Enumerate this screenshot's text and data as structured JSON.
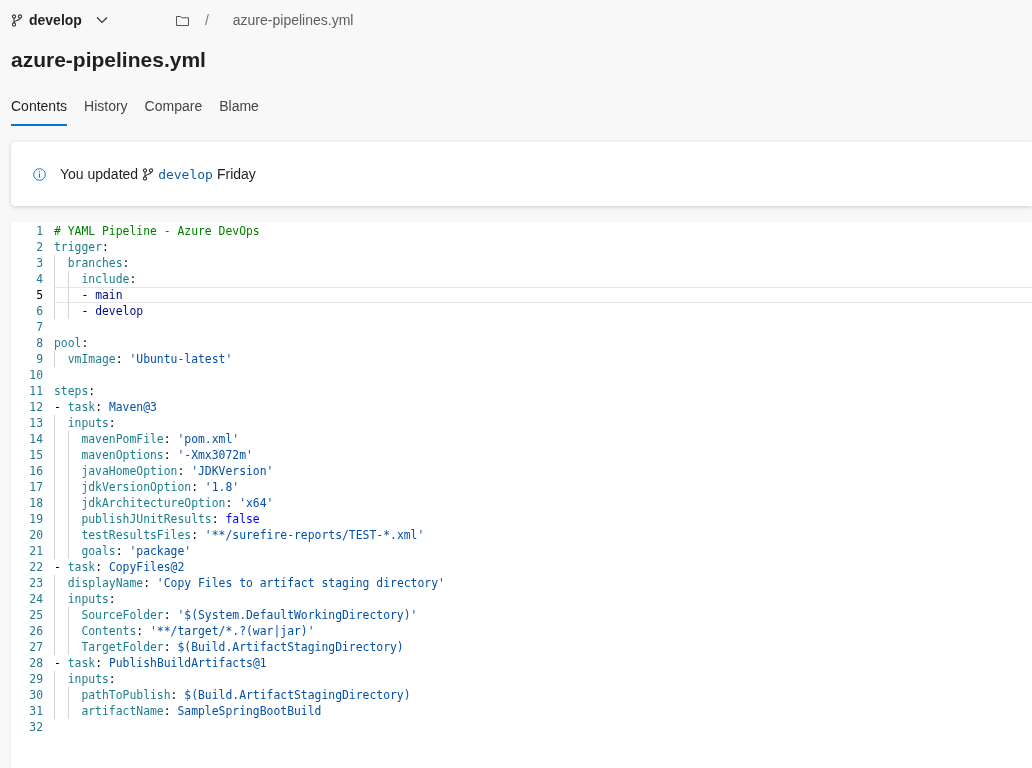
{
  "header": {
    "branch": "develop",
    "breadcrumb_separator": "/",
    "breadcrumb_file": "azure-pipelines.yml"
  },
  "title": "azure-pipelines.yml",
  "tabs": [
    {
      "label": "Contents",
      "selected": true
    },
    {
      "label": "History",
      "selected": false
    },
    {
      "label": "Compare",
      "selected": false
    },
    {
      "label": "Blame",
      "selected": false
    }
  ],
  "notice": {
    "before": "You updated",
    "branch": "develop",
    "after": "Friday"
  },
  "code": [
    {
      "number": "1",
      "current": false,
      "tokens": [
        {
          "kind": "comment",
          "text": "# YAML Pipeline - Azure DevOps"
        }
      ]
    },
    {
      "number": "2",
      "current": false,
      "tokens": [
        {
          "kind": "key",
          "text": "trigger"
        },
        {
          "kind": "punct",
          "text": ":"
        }
      ],
      "children": [
        {
          "number": "3",
          "current": false,
          "tokens": [
            {
              "kind": "key",
              "text": "branches"
            },
            {
              "kind": "punct",
              "text": ":"
            }
          ],
          "children": [
            {
              "number": "4",
              "current": false,
              "tokens": [
                {
                  "kind": "key",
                  "text": "include"
                },
                {
                  "kind": "punct",
                  "text": ":"
                }
              ]
            },
            {
              "number": "5",
              "current": true,
              "tokens": [
                {
                  "kind": "punct",
                  "text": "- "
                },
                {
                  "kind": "plain",
                  "text": "main"
                }
              ]
            },
            {
              "number": "6",
              "current": false,
              "tokens": [
                {
                  "kind": "punct",
                  "text": "- "
                },
                {
                  "kind": "plain",
                  "text": "develop"
                }
              ]
            }
          ]
        }
      ]
    },
    {
      "number": "7",
      "current": false
    },
    {
      "number": "8",
      "current": false,
      "tokens": [
        {
          "kind": "key",
          "text": "pool"
        },
        {
          "kind": "punct",
          "text": ":"
        }
      ],
      "children": [
        {
          "number": "9",
          "current": false,
          "tokens": [
            {
              "kind": "key",
              "text": "vmImage"
            },
            {
              "kind": "punct",
              "text": ": "
            },
            {
              "kind": "string",
              "text": "'Ubuntu-latest'"
            }
          ]
        }
      ]
    },
    {
      "number": "10",
      "current": false
    },
    {
      "number": "11",
      "current": false,
      "tokens": [
        {
          "kind": "key",
          "text": "steps"
        },
        {
          "kind": "punct",
          "text": ":"
        }
      ]
    },
    {
      "number": "12",
      "current": false,
      "tokens": [
        {
          "kind": "punct",
          "text": "- "
        },
        {
          "kind": "key",
          "text": "task"
        },
        {
          "kind": "punct",
          "text": ": "
        },
        {
          "kind": "string",
          "text": "Maven@3"
        }
      ],
      "children": [
        {
          "number": "13",
          "current": false,
          "tokens": [
            {
              "kind": "key",
              "text": "inputs"
            },
            {
              "kind": "punct",
              "text": ":"
            }
          ],
          "children": [
            {
              "number": "14",
              "current": false,
              "tokens": [
                {
                  "kind": "key",
                  "text": "mavenPomFile"
                },
                {
                  "kind": "punct",
                  "text": ": "
                },
                {
                  "kind": "string",
                  "text": "'pom.xml'"
                }
              ]
            },
            {
              "number": "15",
              "current": false,
              "tokens": [
                {
                  "kind": "key",
                  "text": "mavenOptions"
                },
                {
                  "kind": "punct",
                  "text": ": "
                },
                {
                  "kind": "string",
                  "text": "'-Xmx3072m'"
                }
              ]
            },
            {
              "number": "16",
              "current": false,
              "tokens": [
                {
                  "kind": "key",
                  "text": "javaHomeOption"
                },
                {
                  "kind": "punct",
                  "text": ": "
                },
                {
                  "kind": "string",
                  "text": "'JDKVersion'"
                }
              ]
            },
            {
              "number": "17",
              "current": false,
              "tokens": [
                {
                  "kind": "key",
                  "text": "jdkVersionOption"
                },
                {
                  "kind": "punct",
                  "text": ": "
                },
                {
                  "kind": "string",
                  "text": "'1.8'"
                }
              ]
            },
            {
              "number": "18",
              "current": false,
              "tokens": [
                {
                  "kind": "key",
                  "text": "jdkArchitectureOption"
                },
                {
                  "kind": "punct",
                  "text": ": "
                },
                {
                  "kind": "string",
                  "text": "'x64'"
                }
              ]
            },
            {
              "number": "19",
              "current": false,
              "tokens": [
                {
                  "kind": "key",
                  "text": "publishJUnitResults"
                },
                {
                  "kind": "punct",
                  "text": ": "
                },
                {
                  "kind": "bool",
                  "text": "false"
                }
              ]
            },
            {
              "number": "20",
              "current": false,
              "tokens": [
                {
                  "kind": "key",
                  "text": "testResultsFiles"
                },
                {
                  "kind": "punct",
                  "text": ": "
                },
                {
                  "kind": "string",
                  "text": "'**/surefire-reports/TEST-*.xml'"
                }
              ]
            },
            {
              "number": "21",
              "current": false,
              "tokens": [
                {
                  "kind": "key",
                  "text": "goals"
                },
                {
                  "kind": "punct",
                  "text": ": "
                },
                {
                  "kind": "string",
                  "text": "'package'"
                }
              ]
            }
          ]
        }
      ]
    },
    {
      "number": "22",
      "current": false,
      "tokens": [
        {
          "kind": "punct",
          "text": "- "
        },
        {
          "kind": "key",
          "text": "task"
        },
        {
          "kind": "punct",
          "text": ": "
        },
        {
          "kind": "string",
          "text": "CopyFiles@2"
        }
      ],
      "children": [
        {
          "number": "23",
          "current": false,
          "tokens": [
            {
              "kind": "key",
              "text": "displayName"
            },
            {
              "kind": "punct",
              "text": ": "
            },
            {
              "kind": "string",
              "text": "'Copy Files to artifact staging directory'"
            }
          ]
        },
        {
          "number": "24",
          "current": false,
          "tokens": [
            {
              "kind": "key",
              "text": "inputs"
            },
            {
              "kind": "punct",
              "text": ":"
            }
          ],
          "children": [
            {
              "number": "25",
              "current": false,
              "tokens": [
                {
                  "kind": "key",
                  "text": "SourceFolder"
                },
                {
                  "kind": "punct",
                  "text": ": "
                },
                {
                  "kind": "string",
                  "text": "'$(System.DefaultWorkingDirectory)'"
                }
              ]
            },
            {
              "number": "26",
              "current": false,
              "tokens": [
                {
                  "kind": "key",
                  "text": "Contents"
                },
                {
                  "kind": "punct",
                  "text": ": "
                },
                {
                  "kind": "string",
                  "text": "'**/target/*.?(war|jar)'"
                }
              ]
            },
            {
              "number": "27",
              "current": false,
              "tokens": [
                {
                  "kind": "key",
                  "text": "TargetFolder"
                },
                {
                  "kind": "punct",
                  "text": ": "
                },
                {
                  "kind": "string",
                  "text": "$(Build.ArtifactStagingDirectory)"
                }
              ]
            }
          ]
        }
      ]
    },
    {
      "number": "28",
      "current": false,
      "tokens": [
        {
          "kind": "punct",
          "text": "- "
        },
        {
          "kind": "key",
          "text": "task"
        },
        {
          "kind": "punct",
          "text": ": "
        },
        {
          "kind": "string",
          "text": "PublishBuildArtifacts@1"
        }
      ],
      "children": [
        {
          "number": "29",
          "current": false,
          "tokens": [
            {
              "kind": "key",
              "text": "inputs"
            },
            {
              "kind": "punct",
              "text": ":"
            }
          ],
          "children": [
            {
              "number": "30",
              "current": false,
              "tokens": [
                {
                  "kind": "key",
                  "text": "pathToPublish"
                },
                {
                  "kind": "punct",
                  "text": ": "
                },
                {
                  "kind": "string",
                  "text": "$(Build.ArtifactStagingDirectory)"
                }
              ]
            },
            {
              "number": "31",
              "current": false,
              "tokens": [
                {
                  "kind": "key",
                  "text": "artifactName"
                },
                {
                  "kind": "punct",
                  "text": ": "
                },
                {
                  "kind": "string",
                  "text": "SampleSpringBootBuild"
                }
              ]
            }
          ]
        }
      ]
    },
    {
      "number": "32",
      "current": false
    }
  ]
}
